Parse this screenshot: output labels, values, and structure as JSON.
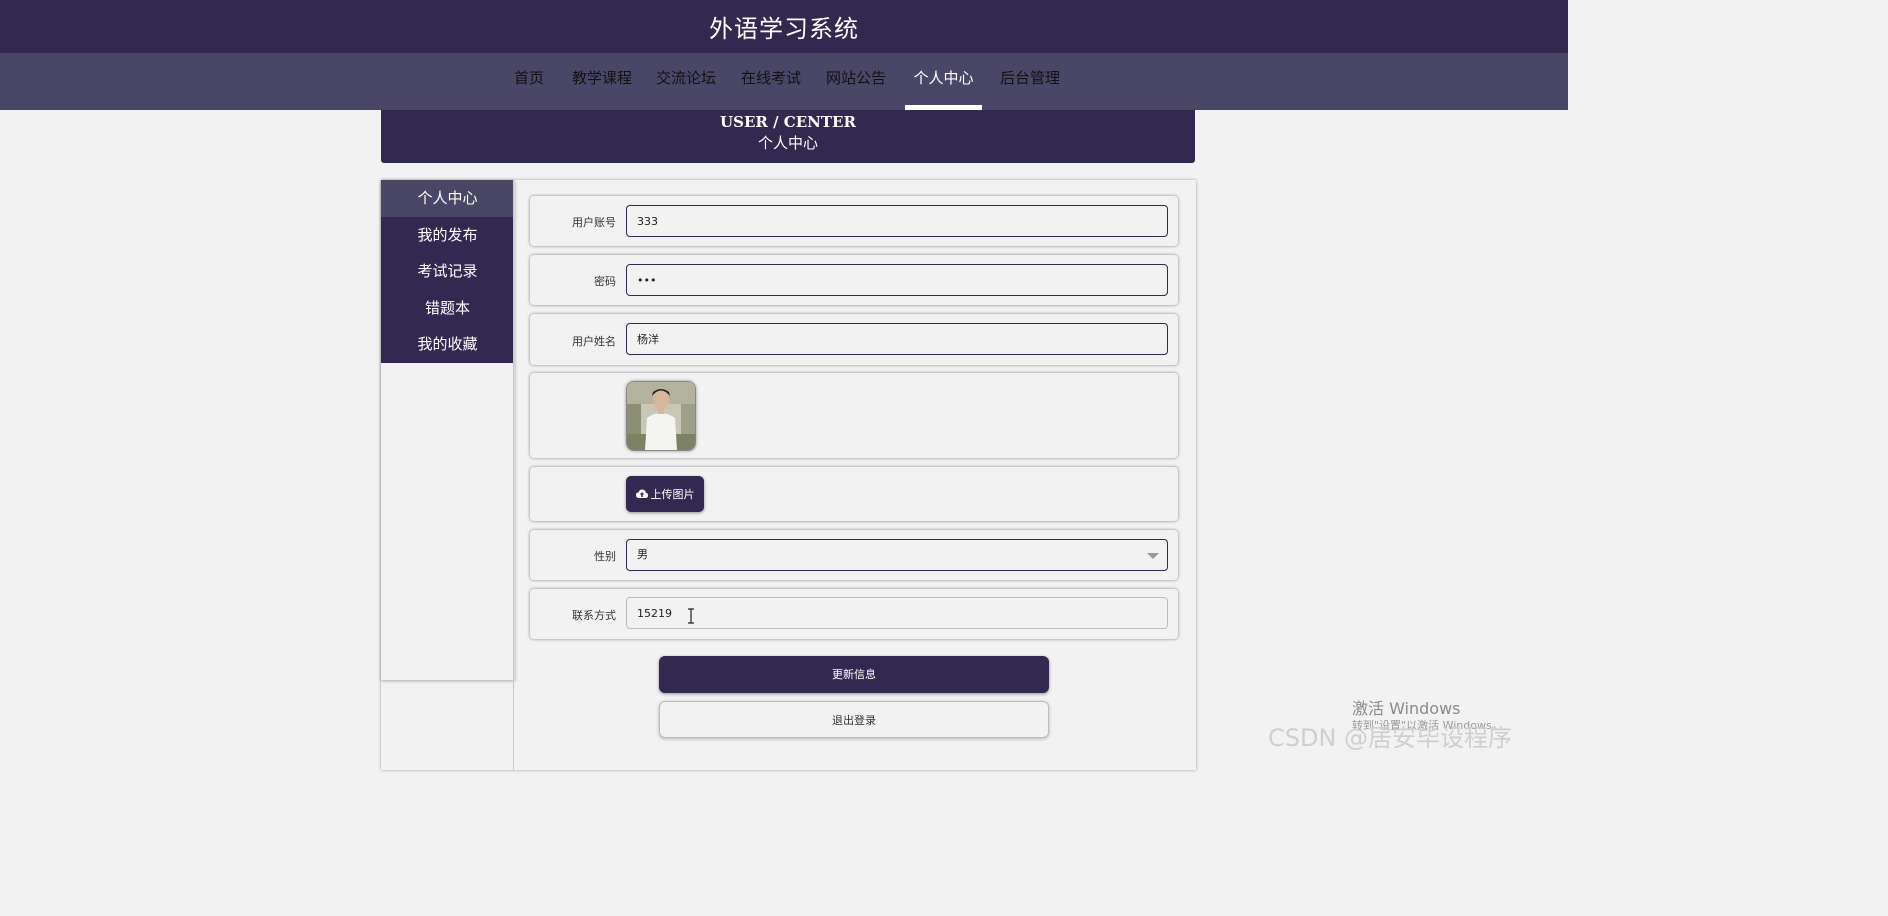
{
  "app": {
    "title": "外语学习系统"
  },
  "nav": {
    "items": [
      {
        "label": "首页"
      },
      {
        "label": "教学课程"
      },
      {
        "label": "交流论坛"
      },
      {
        "label": "在线考试"
      },
      {
        "label": "网站公告"
      },
      {
        "label": "个人中心",
        "active": true
      },
      {
        "label": "后台管理"
      }
    ]
  },
  "banner": {
    "english": "USER / CENTER",
    "chinese": "个人中心"
  },
  "sidebar": {
    "items": [
      {
        "label": "个人中心",
        "active": true
      },
      {
        "label": "我的发布"
      },
      {
        "label": "考试记录"
      },
      {
        "label": "错题本"
      },
      {
        "label": "我的收藏"
      }
    ]
  },
  "form": {
    "account": {
      "label": "用户账号",
      "value": "333"
    },
    "password": {
      "label": "密码",
      "value": "•••"
    },
    "name": {
      "label": "用户姓名",
      "value": "杨洋"
    },
    "upload": {
      "label": "上传图片",
      "icon": "cloud-upload-icon"
    },
    "gender": {
      "label": "性别",
      "value": "男"
    },
    "contact": {
      "label": "联系方式",
      "value": "15219"
    }
  },
  "actions": {
    "update": "更新信息",
    "logout": "退出登录"
  },
  "watermarks": {
    "windows_title": "激活 Windows",
    "windows_sub": "转到\"设置\"以激活 Windows。",
    "csdn": "CSDN @居安毕设程序"
  },
  "colors": {
    "primary": "#332950",
    "nav": "#4a4766",
    "background": "#f2f2f2"
  }
}
